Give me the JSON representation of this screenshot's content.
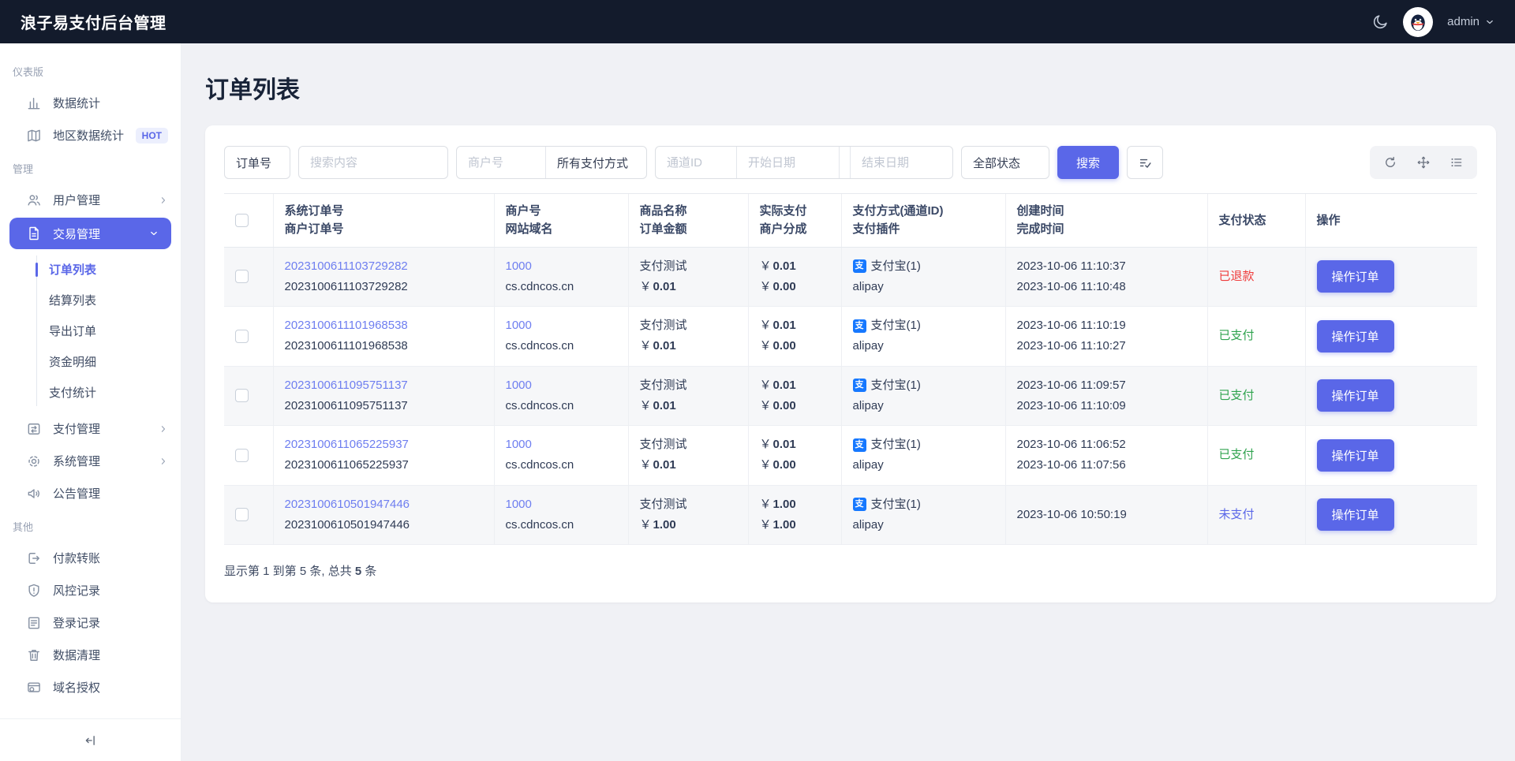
{
  "app": {
    "title": "浪子易支付后台管理",
    "user": "admin"
  },
  "colors": {
    "accent": "#5a67e8",
    "link": "#6e7ef0",
    "header_bg": "#131b2c",
    "status_refunded": "#ef3b3b",
    "status_paid": "#2fa34e",
    "status_unpaid": "#5a67e8",
    "alipay_icon": "#1678ff"
  },
  "currency": "￥",
  "alipay_glyph": "支",
  "sidebar": {
    "sections": [
      {
        "label": "仪表版",
        "items": [
          {
            "label": "数据统计",
            "icon": "bar-chart-icon"
          },
          {
            "label": "地区数据统计",
            "icon": "map-icon",
            "badge": "HOT"
          }
        ]
      },
      {
        "label": "管理",
        "items": [
          {
            "label": "用户管理",
            "icon": "users-icon"
          },
          {
            "label": "交易管理",
            "icon": "document-icon",
            "active": true,
            "children": [
              {
                "label": "订单列表",
                "active": true
              },
              {
                "label": "结算列表"
              },
              {
                "label": "导出订单"
              },
              {
                "label": "资金明细"
              },
              {
                "label": "支付统计"
              }
            ]
          },
          {
            "label": "支付管理",
            "icon": "transfer-icon"
          },
          {
            "label": "系统管理",
            "icon": "gear-icon"
          },
          {
            "label": "公告管理",
            "icon": "megaphone-icon"
          }
        ]
      },
      {
        "label": "其他",
        "items": [
          {
            "label": "付款转账",
            "icon": "payout-icon"
          },
          {
            "label": "风控记录",
            "icon": "shield-icon"
          },
          {
            "label": "登录记录",
            "icon": "log-icon"
          },
          {
            "label": "数据清理",
            "icon": "trash-icon"
          },
          {
            "label": "域名授权",
            "icon": "domain-icon"
          }
        ]
      }
    ]
  },
  "page": {
    "title": "订单列表"
  },
  "filters": {
    "order_field": "订单号",
    "keyword_placeholder": "搜索内容",
    "merchant_placeholder": "商户号",
    "method": "所有支付方式",
    "channel_placeholder": "通道ID",
    "start_date_placeholder": "开始日期",
    "end_date_placeholder": "结束日期",
    "status": "全部状态",
    "search_label": "搜索"
  },
  "table": {
    "headers": [
      {
        "l1": "系统订单号",
        "l2": "商户订单号"
      },
      {
        "l1": "商户号",
        "l2": "网站域名"
      },
      {
        "l1": "商品名称",
        "l2": "订单金额"
      },
      {
        "l1": "实际支付",
        "l2": "商户分成"
      },
      {
        "l1": "支付方式(通道ID)",
        "l2": "支付插件"
      },
      {
        "l1": "创建时间",
        "l2": "完成时间"
      },
      {
        "l1": "支付状态",
        "l2": ""
      },
      {
        "l1": "操作",
        "l2": ""
      }
    ],
    "rows": [
      {
        "sys_order": "2023100611103729282",
        "merch_order": "2023100611103729282",
        "merchant_id": "1000",
        "domain": "cs.cdncos.cn",
        "product": "支付测试",
        "amount": "0.01",
        "paid": "0.01",
        "share": "0.00",
        "method": "支付宝(1)",
        "plugin": "alipay",
        "created": "2023-10-06 11:10:37",
        "completed": "2023-10-06 11:10:48",
        "status": "已退款",
        "action": "操作订单"
      },
      {
        "sys_order": "2023100611101968538",
        "merch_order": "2023100611101968538",
        "merchant_id": "1000",
        "domain": "cs.cdncos.cn",
        "product": "支付测试",
        "amount": "0.01",
        "paid": "0.01",
        "share": "0.00",
        "method": "支付宝(1)",
        "plugin": "alipay",
        "created": "2023-10-06 11:10:19",
        "completed": "2023-10-06 11:10:27",
        "status": "已支付",
        "action": "操作订单"
      },
      {
        "sys_order": "2023100611095751137",
        "merch_order": "2023100611095751137",
        "merchant_id": "1000",
        "domain": "cs.cdncos.cn",
        "product": "支付测试",
        "amount": "0.01",
        "paid": "0.01",
        "share": "0.00",
        "method": "支付宝(1)",
        "plugin": "alipay",
        "created": "2023-10-06 11:09:57",
        "completed": "2023-10-06 11:10:09",
        "status": "已支付",
        "action": "操作订单"
      },
      {
        "sys_order": "2023100611065225937",
        "merch_order": "2023100611065225937",
        "merchant_id": "1000",
        "domain": "cs.cdncos.cn",
        "product": "支付测试",
        "amount": "0.01",
        "paid": "0.01",
        "share": "0.00",
        "method": "支付宝(1)",
        "plugin": "alipay",
        "created": "2023-10-06 11:06:52",
        "completed": "2023-10-06 11:07:56",
        "status": "已支付",
        "action": "操作订单"
      },
      {
        "sys_order": "2023100610501947446",
        "merch_order": "2023100610501947446",
        "merchant_id": "1000",
        "domain": "cs.cdncos.cn",
        "product": "支付测试",
        "amount": "1.00",
        "paid": "1.00",
        "share": "1.00",
        "method": "支付宝(1)",
        "plugin": "alipay",
        "created": "2023-10-06 10:50:19",
        "completed": "",
        "status": "未支付",
        "action": "操作订单"
      }
    ],
    "summary_prefix": "显示第 1 到第 5 条, 总共 ",
    "summary_total": "5",
    "summary_suffix": " 条"
  }
}
